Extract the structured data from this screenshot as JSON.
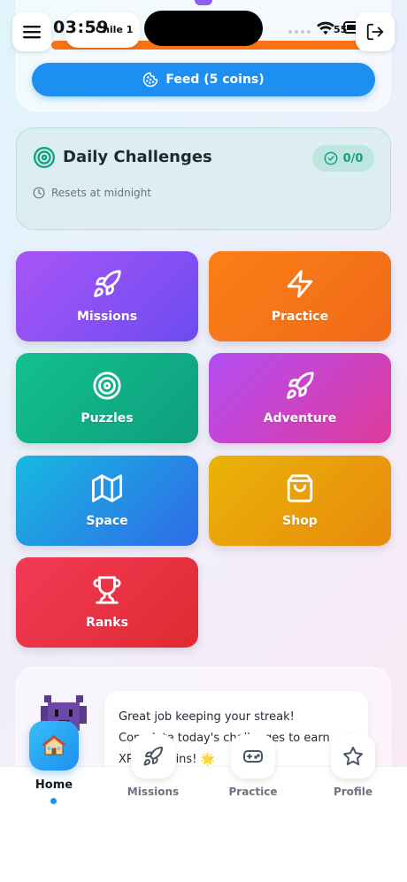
{
  "status_bar": {
    "time": "03:59",
    "carrier": "Chile 1",
    "battery": "55"
  },
  "pet_card": {
    "feed_button": "Feed (5 coins)"
  },
  "daily_challenges": {
    "title": "Daily Challenges",
    "progress": "0/0",
    "reset_text": "Resets at midnight"
  },
  "tiles": [
    {
      "label": "Missions",
      "icon": "rocket-icon",
      "color": "#8b5cf6"
    },
    {
      "label": "Practice",
      "icon": "lightning-icon",
      "color": "#f97316"
    },
    {
      "label": "Puzzles",
      "icon": "target-icon",
      "color": "#10b981"
    },
    {
      "label": "Adventure",
      "icon": "rocket-icon",
      "color": "#c026d3"
    },
    {
      "label": "Space",
      "icon": "map-icon",
      "color": "#0ea5e9"
    },
    {
      "label": "Shop",
      "icon": "shopping-bag-icon",
      "color": "#eab308"
    },
    {
      "label": "Ranks",
      "icon": "trophy-icon",
      "color": "#ef4444"
    }
  ],
  "message": {
    "line1": "Great job keeping your streak!",
    "line2": "Complete today's challenges to earn",
    "line3": "XP and coins! 🌟"
  },
  "bottom_nav": {
    "home": "Home",
    "missions": "Missions",
    "practice": "Practice",
    "profile": "Profile"
  },
  "colors": {
    "accent": "#1d8ff0",
    "challenge_green": "#16a085"
  }
}
